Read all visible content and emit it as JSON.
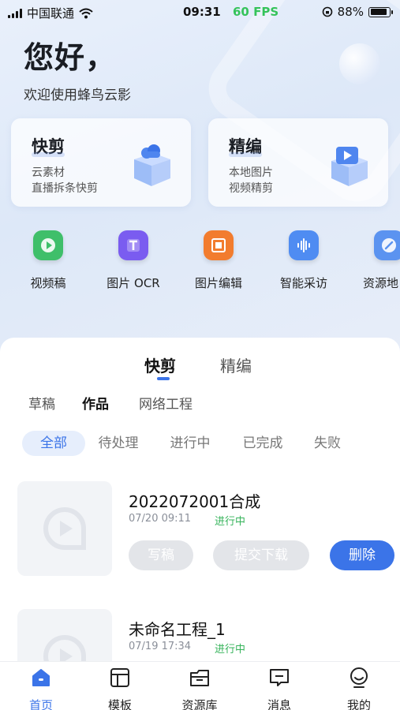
{
  "status_bar": {
    "carrier": "中国联通",
    "time": "09:31",
    "fps": "60 FPS",
    "battery": "88%",
    "battery_level": 0.88
  },
  "header": {
    "greeting": "您好，",
    "welcome": "欢迎使用蜂鸟云影"
  },
  "feature_cards": [
    {
      "title": "快剪",
      "line1": "云素材",
      "line2": "直播拆条快剪",
      "icon": "cloud-cube-icon"
    },
    {
      "title": "精编",
      "line1": "本地图片",
      "line2": "视频精剪",
      "icon": "video-cube-icon"
    }
  ],
  "quick_actions": [
    {
      "label": "视频稿",
      "icon": "video-play-icon",
      "color": "#3fbf6a"
    },
    {
      "label": "图片 OCR",
      "icon": "text-t-icon",
      "color": "#7a5cf0"
    },
    {
      "label": "图片编辑",
      "icon": "crop-icon",
      "color": "#f27c2e"
    },
    {
      "label": "智能采访",
      "icon": "soundwave-icon",
      "color": "#4f8cf2"
    },
    {
      "label": "资源地",
      "icon": "compass-icon",
      "color": "#5b93f0"
    }
  ],
  "main_tabs": [
    {
      "label": "快剪",
      "active": true
    },
    {
      "label": "精编",
      "active": false
    }
  ],
  "sub_tabs": [
    {
      "label": "草稿",
      "active": false
    },
    {
      "label": "作品",
      "active": true
    },
    {
      "label": "网络工程",
      "active": false
    }
  ],
  "filters": [
    {
      "label": "全部",
      "active": true
    },
    {
      "label": "待处理",
      "active": false
    },
    {
      "label": "进行中",
      "active": false
    },
    {
      "label": "已完成",
      "active": false
    },
    {
      "label": "失败",
      "active": false
    }
  ],
  "projects": [
    {
      "title": "2022072001合成",
      "date": "07/20 09:11",
      "status": "进行中",
      "buttons": {
        "script": "写稿",
        "submit": "提交下载",
        "delete": "删除"
      }
    },
    {
      "title": "未命名工程_1",
      "date": "07/19 17:34",
      "status": "进行中"
    }
  ],
  "tabbar": [
    {
      "label": "首页",
      "icon": "home-icon",
      "active": true
    },
    {
      "label": "模板",
      "icon": "template-icon",
      "active": false
    },
    {
      "label": "资源库",
      "icon": "resource-library-icon",
      "active": false
    },
    {
      "label": "消息",
      "icon": "message-icon",
      "active": false
    },
    {
      "label": "我的",
      "icon": "profile-icon",
      "active": false
    }
  ],
  "colors": {
    "accent": "#3b74e8",
    "status_green": "#35b35a",
    "fps_green": "#35c35a"
  }
}
